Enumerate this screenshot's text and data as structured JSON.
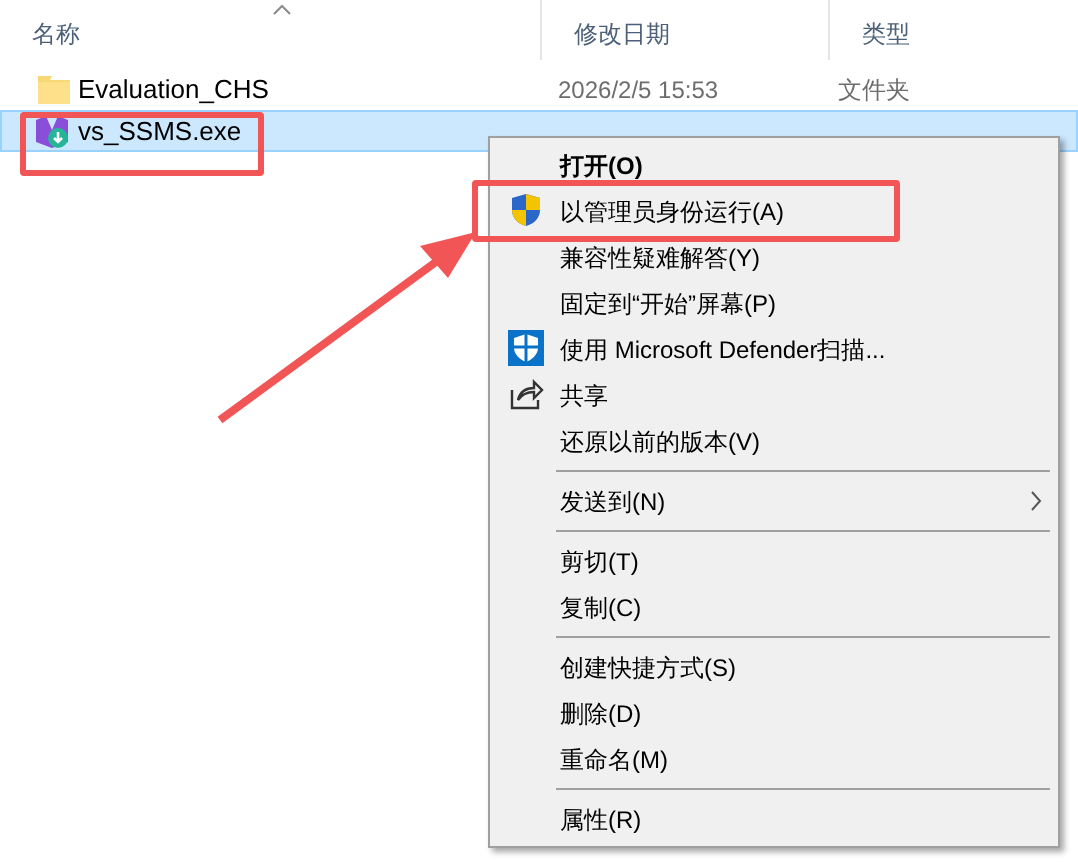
{
  "columns": [
    {
      "label": "名称",
      "sorted": true
    },
    {
      "label": "修改日期",
      "sorted": false
    },
    {
      "label": "类型",
      "sorted": false
    }
  ],
  "files": [
    {
      "kind": "folder",
      "name": "Evaluation_CHS",
      "date": "2026/2/5 15:53",
      "type": "文件夹",
      "selected": false
    },
    {
      "kind": "installer",
      "name": "vs_SSMS.exe",
      "selected": true
    }
  ],
  "context_menu": [
    {
      "kind": "item",
      "label": "打开(O)",
      "default": true
    },
    {
      "kind": "uac",
      "label": "以管理员身份运行(A)",
      "default": false
    },
    {
      "kind": "item",
      "label": "兼容性疑难解答(Y)",
      "default": false
    },
    {
      "kind": "item",
      "label": "固定到“开始”屏幕(P)",
      "default": false
    },
    {
      "kind": "scan",
      "label": "使用 Microsoft Defender扫描...",
      "default": false
    },
    {
      "kind": "share",
      "label": "共享",
      "default": false
    },
    {
      "kind": "item",
      "label": "还原以前的版本(V)",
      "default": false
    },
    {
      "kind": "separator"
    },
    {
      "kind": "submenu",
      "label": "发送到(N)",
      "default": false
    },
    {
      "kind": "separator"
    },
    {
      "kind": "item",
      "label": "剪切(T)",
      "default": false
    },
    {
      "kind": "item",
      "label": "复制(C)",
      "default": false
    },
    {
      "kind": "separator"
    },
    {
      "kind": "item",
      "label": "创建快捷方式(S)",
      "default": false
    },
    {
      "kind": "item",
      "label": "删除(D)",
      "default": false
    },
    {
      "kind": "item",
      "label": "重命名(M)",
      "default": false
    },
    {
      "kind": "separator"
    },
    {
      "kind": "item",
      "label": "属性(R)",
      "default": false
    }
  ]
}
